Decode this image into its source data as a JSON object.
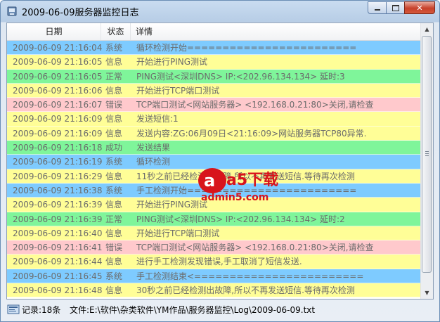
{
  "window": {
    "title": "2009-06-09服务器监控日志"
  },
  "table": {
    "columns": {
      "date": "日期",
      "status": "状态",
      "detail": "详情"
    },
    "rows": [
      {
        "date": "2009-06-09 21:16:04",
        "status": "系统",
        "detail": "循环检测开始========================",
        "color": "#7ecbff"
      },
      {
        "date": "2009-06-09 21:16:05",
        "status": "信息",
        "detail": "开始进行PING测试",
        "color": "#fffe97"
      },
      {
        "date": "2009-06-09 21:16:05",
        "status": "正常",
        "detail": "PING测试<深圳DNS> IP:<202.96.134.134> 延时:3",
        "color": "#7ff59a"
      },
      {
        "date": "2009-06-09 21:16:06",
        "status": "信息",
        "detail": "开始进行TCP端口测试",
        "color": "#fffe97"
      },
      {
        "date": "2009-06-09 21:16:07",
        "status": "错误",
        "detail": "TCP端口测试<网站服务器> <192.168.0.21:80>关闭,请检查",
        "color": "#ffc9cc"
      },
      {
        "date": "2009-06-09 21:16:09",
        "status": "信息",
        "detail": "发送短信:1",
        "color": "#fffe97"
      },
      {
        "date": "2009-06-09 21:16:09",
        "status": "信息",
        "detail": "发送内容:ZG:06月09日<21:16:09>网站服务器TCP80异常.",
        "color": "#fffe97"
      },
      {
        "date": "2009-06-09 21:16:18",
        "status": "成功",
        "detail": "发送结果",
        "color": "#7ff59a"
      },
      {
        "date": "2009-06-09 21:16:19",
        "status": "系统",
        "detail": "循环检测",
        "color": "#7ecbff"
      },
      {
        "date": "2009-06-09 21:16:29",
        "status": "信息",
        "detail": "11秒之前已经检测出故障,所以不再发送短信.等待再次检测",
        "color": "#fffe97"
      },
      {
        "date": "2009-06-09 21:16:38",
        "status": "系统",
        "detail": "手工检测开始========================",
        "color": "#7ecbff"
      },
      {
        "date": "2009-06-09 21:16:39",
        "status": "信息",
        "detail": "开始进行PING测试",
        "color": "#fffe97"
      },
      {
        "date": "2009-06-09 21:16:39",
        "status": "正常",
        "detail": "PING测试<深圳DNS> IP:<202.96.134.134> 延时:2",
        "color": "#7ff59a"
      },
      {
        "date": "2009-06-09 21:16:40",
        "status": "信息",
        "detail": "开始进行TCP端口测试",
        "color": "#fffe97"
      },
      {
        "date": "2009-06-09 21:16:41",
        "status": "错误",
        "detail": "TCP端口测试<网站服务器> <192.168.0.21:80>关闭,请检查",
        "color": "#ffc9cc"
      },
      {
        "date": "2009-06-09 21:16:44",
        "status": "信息",
        "detail": "进行手工检测发现错误,手工取消了短信发送.",
        "color": "#fffe97"
      },
      {
        "date": "2009-06-09 21:16:45",
        "status": "系统",
        "detail": "手工检测结束<========================",
        "color": "#7ecbff"
      },
      {
        "date": "2009-06-09 21:16:48",
        "status": "信息",
        "detail": "30秒之前已经检测出故障,所以不再发送短信.等待再次检测",
        "color": "#fffe97"
      }
    ]
  },
  "statusbar": {
    "count": "记录:18条",
    "file": "文件:E:\\软件\\杂类软件\\YM作品\\服务器监控\\Log\\2009-06-09.txt"
  },
  "watermark": {
    "logo": "a5下载",
    "url": "admin5.com"
  },
  "colors": {
    "text": "#6b6b6b",
    "system": "#7ecbff",
    "info": "#fffe97",
    "ok": "#7ff59a",
    "error": "#ffc9cc"
  }
}
